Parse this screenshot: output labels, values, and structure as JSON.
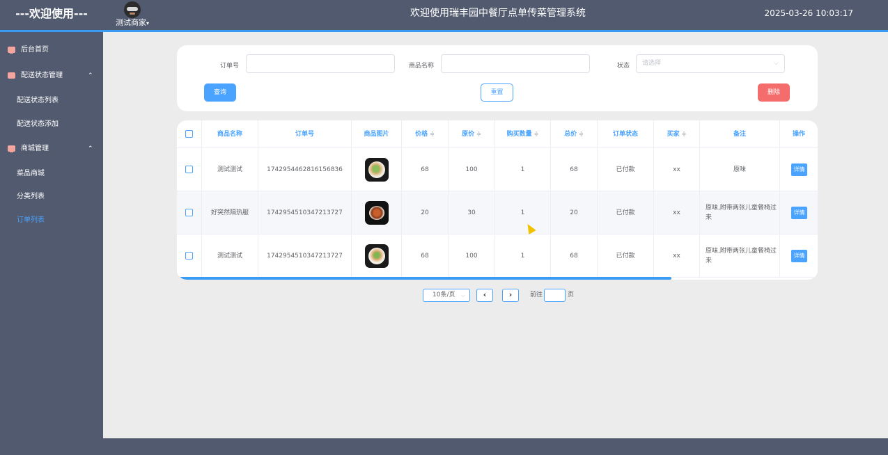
{
  "header": {
    "brand": "---欢迎使用---",
    "user_name": "测试商家",
    "caret": "▾",
    "title": "欢迎使用瑞丰园中餐厅点单传菜管理系统",
    "datetime": "2025-03-26 10:03:17"
  },
  "sidebar": {
    "items": [
      {
        "label": "后台首页",
        "icon": "monitor-icon"
      },
      {
        "label": "配送状态管理",
        "icon": "chart-icon",
        "chevron": "⌃"
      },
      {
        "label": "配送状态列表"
      },
      {
        "label": "配送状态添加"
      },
      {
        "label": "商城管理",
        "icon": "monitor-icon",
        "chevron": "⌃"
      },
      {
        "label": "菜品商城"
      },
      {
        "label": "分类列表"
      },
      {
        "label": "订单列表",
        "active": true
      }
    ]
  },
  "search": {
    "order_no_label": "订单号",
    "order_no_value": "",
    "product_name_label": "商品名称",
    "product_name_value": "",
    "status_label": "状态",
    "status_placeholder": "请选择",
    "chevron": "⌵",
    "query_button": "查询",
    "reset_button": "重置",
    "delete_button": "删除"
  },
  "table": {
    "columns": [
      "商品名称",
      "订单号",
      "商品图片",
      "价格",
      "原价",
      "购买数量",
      "总价",
      "订单状态",
      "买家",
      "备注",
      "操作"
    ],
    "sort_glyph": "≑",
    "rows": [
      {
        "name": "测试测试",
        "order_no": "1742954462816156836",
        "price": "68",
        "original_price": "100",
        "quantity": "1",
        "total": "68",
        "status": "已付款",
        "buyer": "xx",
        "note": "原味",
        "action": "详情"
      },
      {
        "name": "好突然隔热服",
        "order_no": "1742954510347213727",
        "price": "20",
        "original_price": "30",
        "quantity": "1",
        "total": "20",
        "status": "已付款",
        "buyer": "xx",
        "note": "原味,附带两张儿童餐椅过来",
        "action": "详情"
      },
      {
        "name": "测试测试",
        "order_no": "1742954510347213727",
        "price": "68",
        "original_price": "100",
        "quantity": "1",
        "total": "68",
        "status": "已付款",
        "buyer": "xx",
        "note": "原味,附带两张儿童餐椅过来",
        "action": "详情"
      }
    ]
  },
  "pagination": {
    "page_size": "10条/页",
    "prev": "‹",
    "next": "›",
    "goto_label": "前往",
    "page_unit": "页"
  },
  "colors": {
    "header_bg": "#515a6e",
    "accent": "#4aa3ff",
    "danger": "#f56c6c",
    "content_bg": "#ececec"
  }
}
